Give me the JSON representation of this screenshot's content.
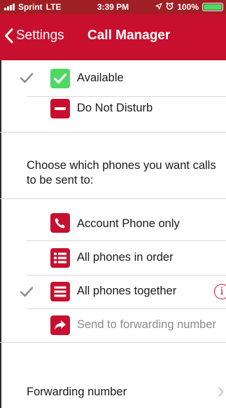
{
  "status_bar": {
    "carrier": "Sprint",
    "network": "LTE",
    "time": "3:39 PM",
    "battery": "100%",
    "battery_level": 100,
    "icons": [
      "signal-icon",
      "location-icon",
      "alarm-icon",
      "battery-icon"
    ]
  },
  "nav": {
    "back_label": "Settings",
    "title": "Call Manager"
  },
  "availability": [
    {
      "label": "Available",
      "checked": true,
      "icon": "check-icon",
      "icon_color": "#4cd964"
    },
    {
      "label": "Do Not Disturb",
      "checked": false,
      "icon": "minus-icon",
      "icon_color": "#c8102e"
    }
  ],
  "section_heading": "Choose which phones you want calls to be sent to:",
  "routing": [
    {
      "label": "Account Phone only",
      "checked": false,
      "icon": "phone-icon",
      "disabled": false
    },
    {
      "label": "All phones in order",
      "checked": false,
      "icon": "ordered-list-icon",
      "disabled": false
    },
    {
      "label": "All phones together",
      "checked": true,
      "icon": "stacked-list-icon",
      "disabled": false,
      "info": true
    },
    {
      "label": "Send to forwarding number",
      "checked": false,
      "icon": "forward-arrow-icon",
      "disabled": true
    }
  ],
  "info_glyph": "i",
  "forwarding": {
    "label": "Forwarding number"
  },
  "colors": {
    "brand_red": "#c8102e",
    "status_bar_red": "#a01f24",
    "green": "#4cd964",
    "check_gray": "#8e8e8e",
    "divider": "#d7d7d7"
  }
}
